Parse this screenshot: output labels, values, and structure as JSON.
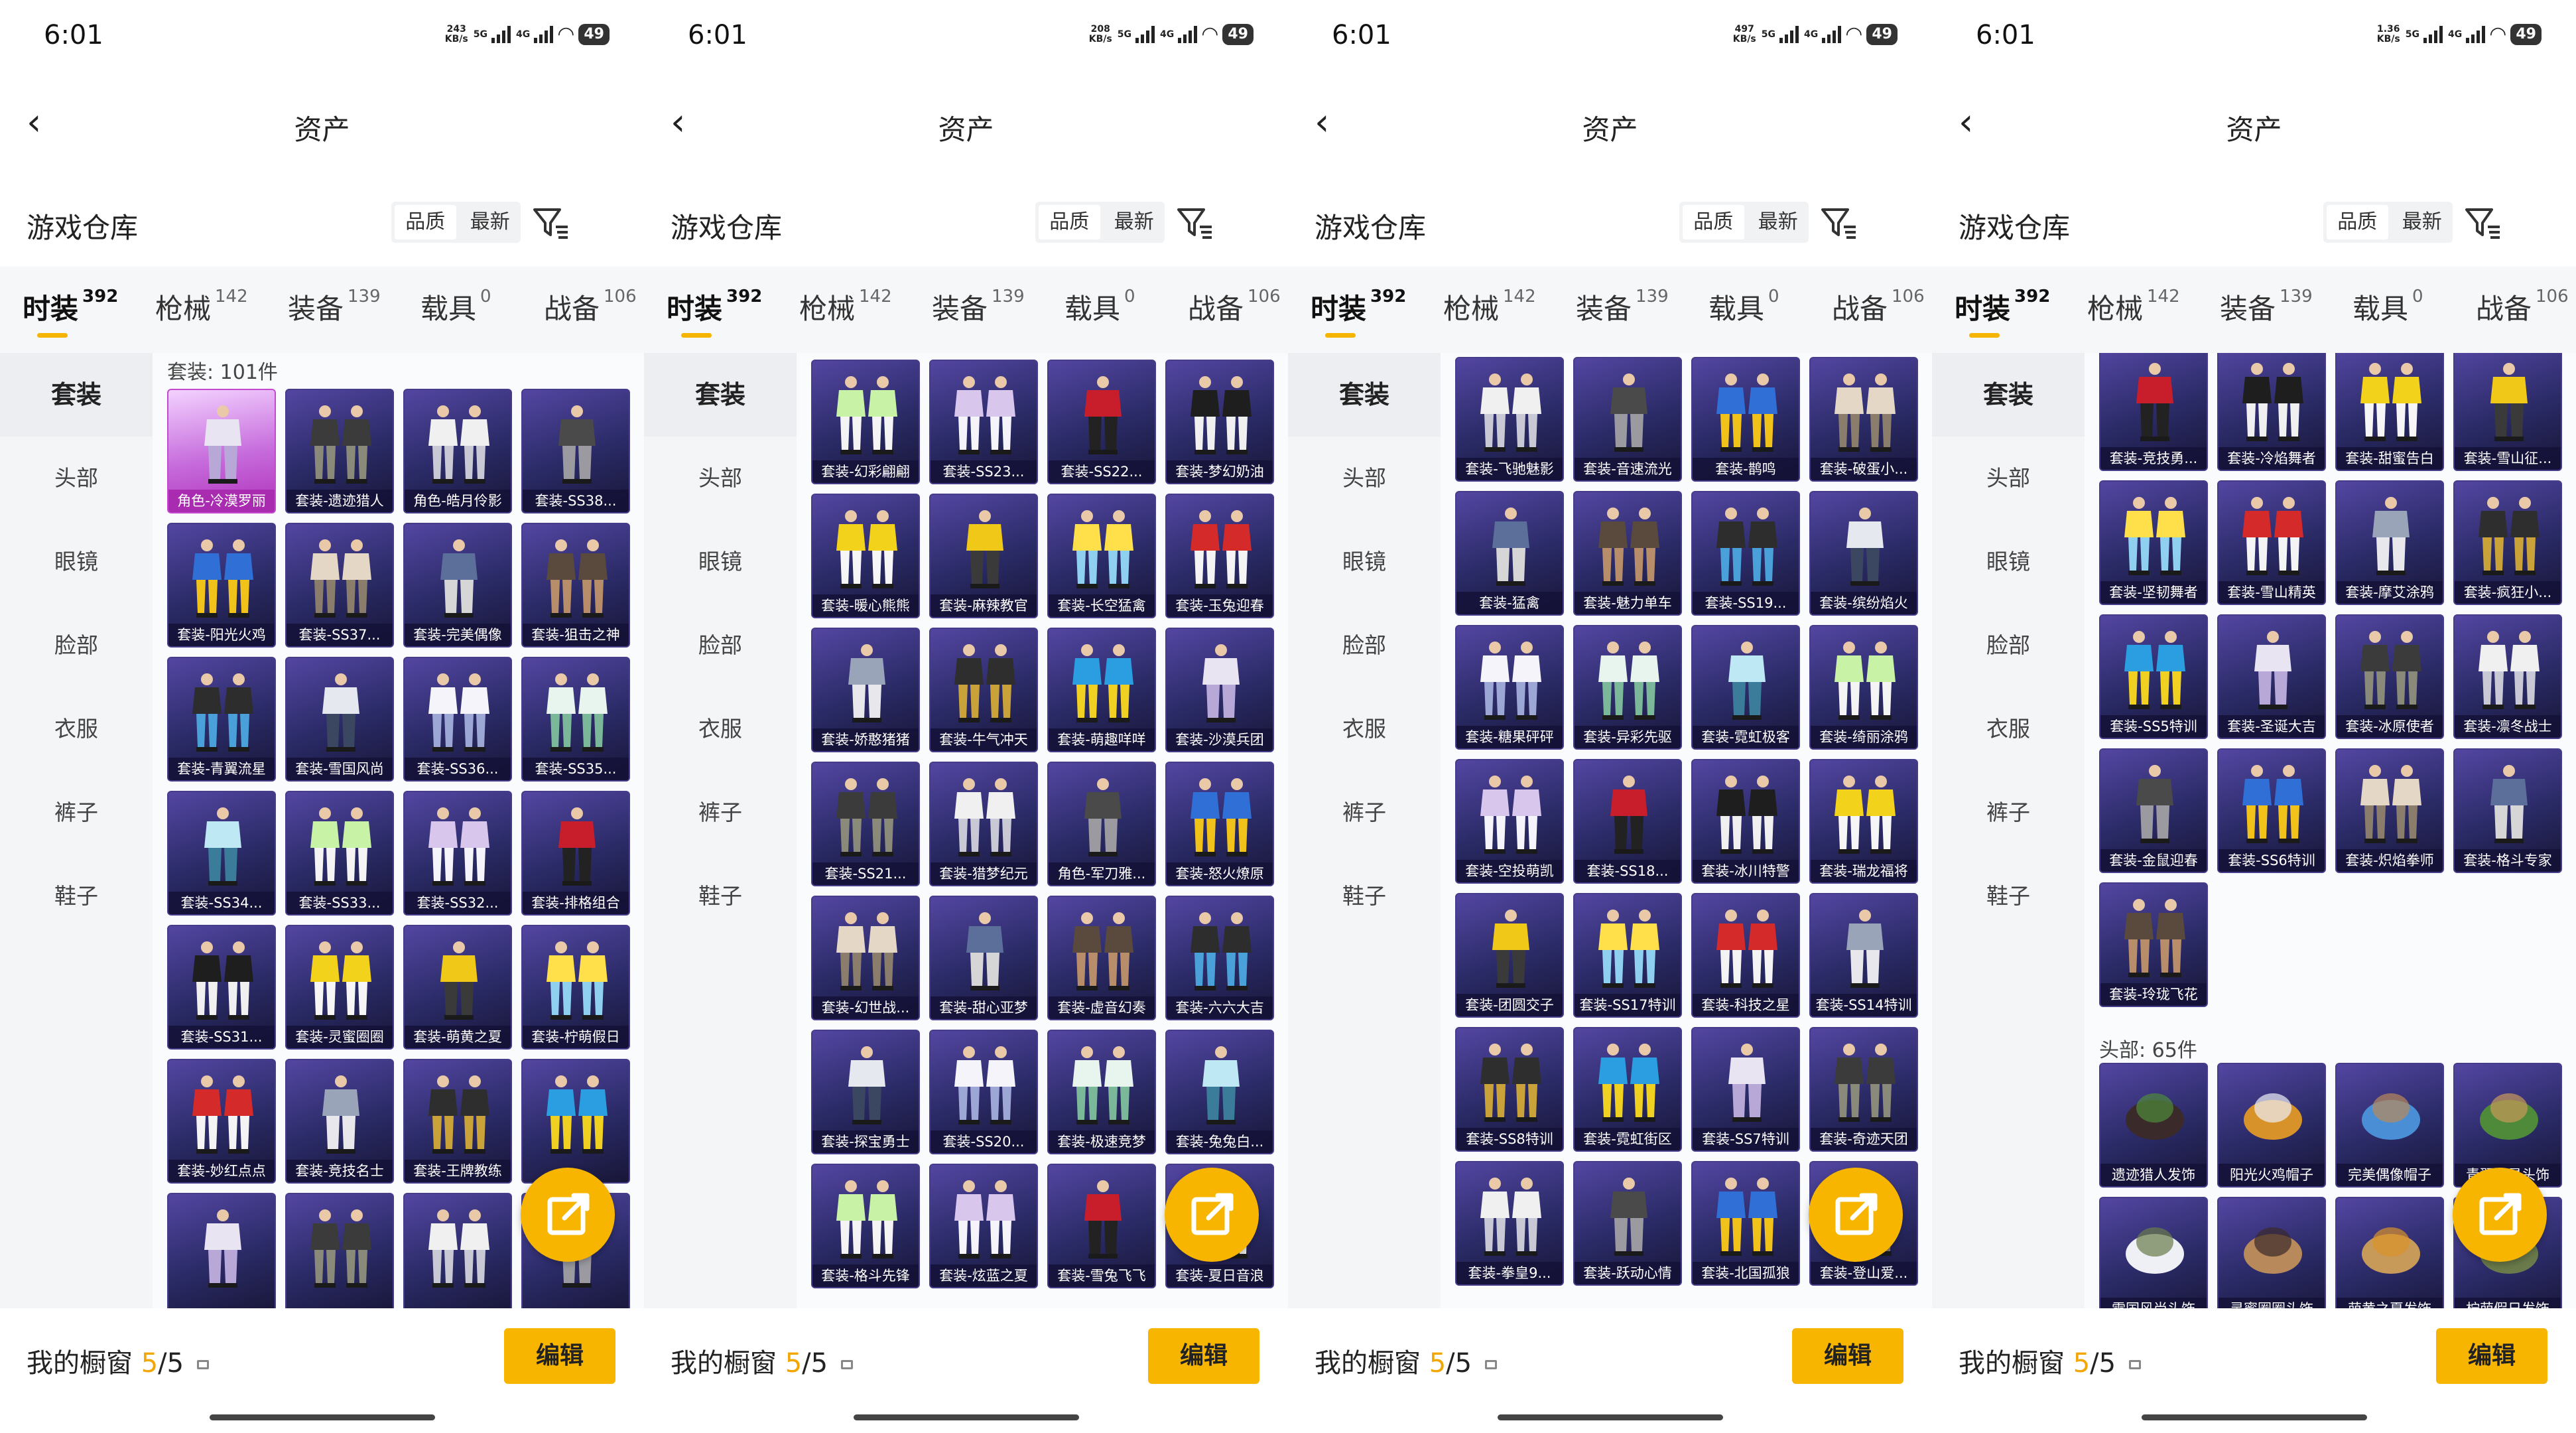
{
  "status_time": "6:01",
  "battery": "49",
  "page_title": "资产",
  "warehouse_title": "游戏仓库",
  "sort_options": [
    "品质",
    "最新"
  ],
  "tabs": [
    {
      "label": "时装",
      "count": "392"
    },
    {
      "label": "枪械",
      "count": "142"
    },
    {
      "label": "装备",
      "count": "139"
    },
    {
      "label": "载具",
      "count": "0"
    },
    {
      "label": "战备",
      "count": "106"
    }
  ],
  "sidebar": [
    "套装",
    "头部",
    "眼镜",
    "脸部",
    "衣服",
    "裤子",
    "鞋子"
  ],
  "cabinet_label": "我的橱窗",
  "cabinet_used": "5",
  "cabinet_total": "/5",
  "edit_label": "编辑",
  "colors": {
    "accent": "#f7b500",
    "card_bg": "#2a2a66",
    "legendary": "#c24bcd"
  },
  "screens": [
    {
      "speed_top": "243",
      "speed_unit": "KB/s",
      "groups": [
        {
          "header": "套装: 101件",
          "items": [
            "角色-冷漠罗丽",
            "套装-遗迹猎人",
            "角色-皓月伶影",
            "套装-SS38...",
            "套装-阳光火鸡",
            "套装-SS37...",
            "套装-完美偶像",
            "套装-狙击之神",
            "套装-青翼流星",
            "套装-雪国风尚",
            "套装-SS36...",
            "套装-SS35...",
            "套装-SS34...",
            "套装-SS33...",
            "套装-SS32...",
            "套装-排格组合",
            "套装-SS31...",
            "套装-灵蜜圈圈",
            "套装-萌黄之夏",
            "套装-柠萌假日",
            "套装-妙红点点",
            "套装-竞技名士",
            "套装-王牌教练",
            "",
            "",
            "",
            "",
            ""
          ]
        }
      ]
    },
    {
      "speed_top": "208",
      "speed_unit": "KB/s",
      "groups": [
        {
          "header": "",
          "items": [
            "套装-幻彩翩翩",
            "套装-SS23...",
            "套装-SS22...",
            "套装-梦幻奶油",
            "套装-暖心熊熊",
            "套装-麻辣教官",
            "套装-长空猛禽",
            "套装-玉兔迎春",
            "套装-娇憨猪猪",
            "套装-牛气冲天",
            "套装-萌趣咩咩",
            "套装-沙漠兵团",
            "套装-SS21...",
            "套装-猎梦纪元",
            "角色-军刀雅...",
            "套装-怒火燎原",
            "套装-幻世战...",
            "套装-甜心亚梦",
            "套装-虚音幻奏",
            "套装-六六大吉",
            "套装-探宝勇士",
            "套装-SS20...",
            "套装-极速竞梦",
            "套装-兔兔白...",
            "套装-格斗先锋",
            "套装-炫蓝之夏",
            "套装-雪兔飞飞",
            "套装-夏日音浪"
          ]
        }
      ]
    },
    {
      "speed_top": "497",
      "speed_unit": "KB/s",
      "groups": [
        {
          "header": "",
          "items": [
            "套装-飞驰魅影",
            "套装-音速流光",
            "套装-鹊鸣",
            "套装-破蛋小...",
            "套装-猛禽",
            "套装-魅力单车",
            "套装-SS19...",
            "套装-缤纷焰火",
            "套装-糖果砰砰",
            "套装-异彩先驱",
            "套装-霓虹极客",
            "套装-绮丽涂鸦",
            "套装-空投萌凯",
            "套装-SS18...",
            "套装-冰川特警",
            "套装-瑞龙福将",
            "套装-团圆交子",
            "套装-SS17特训",
            "套装-科技之星",
            "套装-SS14特训",
            "套装-SS8特训",
            "套装-霓虹街区",
            "套装-SS7特训",
            "套装-奇迹天团",
            "套装-拳皇9...",
            "套装-跃动心情",
            "套装-北国孤狼",
            "套装-登山爱..."
          ]
        }
      ]
    },
    {
      "speed_top": "1.36",
      "speed_unit": "KB/s",
      "groups": [
        {
          "header": "",
          "items": [
            "套装-竞技勇...",
            "套装-冷焰舞者",
            "套装-甜蜜告白",
            "套装-雪山征...",
            "套装-坚韧舞者",
            "套装-雪山精英",
            "套装-摩艾涂鸦",
            "套装-疯狂小...",
            "套装-SS5特训",
            "套装-圣诞大吉",
            "套装-冰原使者",
            "套装-凛冬战士",
            "套装-金鼠迎春",
            "套装-SS6特训",
            "套装-炽焰拳师",
            "套装-格斗专家",
            "套装-玲珑飞花"
          ]
        },
        {
          "header": "头部: 65件",
          "items": [
            "遗迹猎人发饰",
            "阳光火鸡帽子",
            "完美偶像帽子",
            "青翼流星头饰",
            "雪国风尚头饰",
            "灵蜜圈圈头饰",
            "萌黄之夏发饰",
            "柠萌假日发饰"
          ]
        }
      ]
    }
  ]
}
